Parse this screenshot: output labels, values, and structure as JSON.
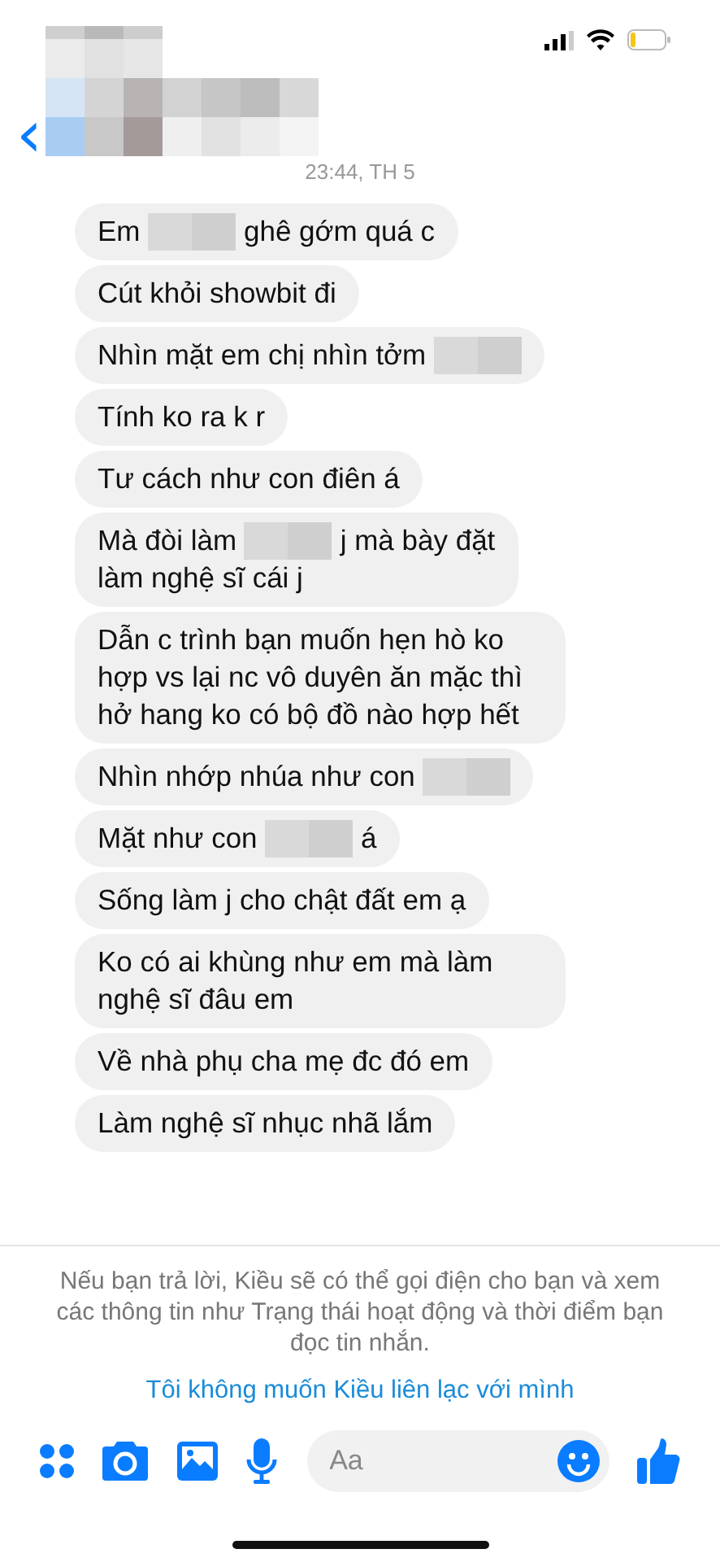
{
  "header": {
    "back": "‹"
  },
  "timestamp": "23:44, TH 5",
  "messages": [
    {
      "lines": [
        [
          {
            "kind": "text",
            "text": "Em"
          },
          {
            "kind": "blur"
          },
          {
            "kind": "text",
            "text": "ghê gớm quá c"
          }
        ]
      ]
    },
    {
      "lines": [
        [
          {
            "kind": "text",
            "text": "Cút khỏi showbit đi"
          }
        ]
      ]
    },
    {
      "lines": [
        [
          {
            "kind": "text",
            "text": "Nhìn mặt em chị nhìn tởm"
          },
          {
            "kind": "blur"
          }
        ]
      ]
    },
    {
      "lines": [
        [
          {
            "kind": "text",
            "text": "Tính ko ra k r"
          }
        ]
      ]
    },
    {
      "lines": [
        [
          {
            "kind": "text",
            "text": "Tư cách như con điên á"
          }
        ]
      ]
    },
    {
      "lines": [
        [
          {
            "kind": "text",
            "text": "Mà đòi làm"
          },
          {
            "kind": "blur"
          },
          {
            "kind": "text",
            "text": "j mà bày đặt"
          }
        ],
        [
          {
            "kind": "text",
            "text": "làm nghệ sĩ cái j"
          }
        ]
      ]
    },
    {
      "lines": [
        [
          {
            "kind": "text",
            "text": "Dẫn c trình bạn muốn hẹn hò ko hợp vs lại nc vô duyên ăn mặc thì hở hang ko có bộ đồ nào hợp hết"
          }
        ]
      ]
    },
    {
      "lines": [
        [
          {
            "kind": "text",
            "text": "Nhìn nhớp nhúa như con"
          },
          {
            "kind": "blur"
          }
        ]
      ]
    },
    {
      "lines": [
        [
          {
            "kind": "text",
            "text": "Mặt như con"
          },
          {
            "kind": "blur"
          },
          {
            "kind": "text",
            "text": "á"
          }
        ]
      ]
    },
    {
      "lines": [
        [
          {
            "kind": "text",
            "text": "Sống làm j cho chật đất em ạ"
          }
        ]
      ]
    },
    {
      "lines": [
        [
          {
            "kind": "text",
            "text": "Ko có ai khùng như em mà làm nghệ sĩ đâu em"
          }
        ]
      ]
    },
    {
      "lines": [
        [
          {
            "kind": "text",
            "text": "Về nhà phụ cha mẹ đc đó em"
          }
        ]
      ]
    },
    {
      "lines": [
        [
          {
            "kind": "text",
            "text": "Làm nghệ sĩ nhục nhã lắm"
          }
        ]
      ]
    }
  ],
  "notice": "Nếu bạn trả lời, Kiều sẽ có thể gọi điện cho bạn và xem các thông tin như Trạng thái hoạt động và thời điểm bạn đọc tin nhắn.",
  "block_link": "Tôi không muốn Kiều liên lạc với mình",
  "composer": {
    "placeholder": "Aa"
  }
}
